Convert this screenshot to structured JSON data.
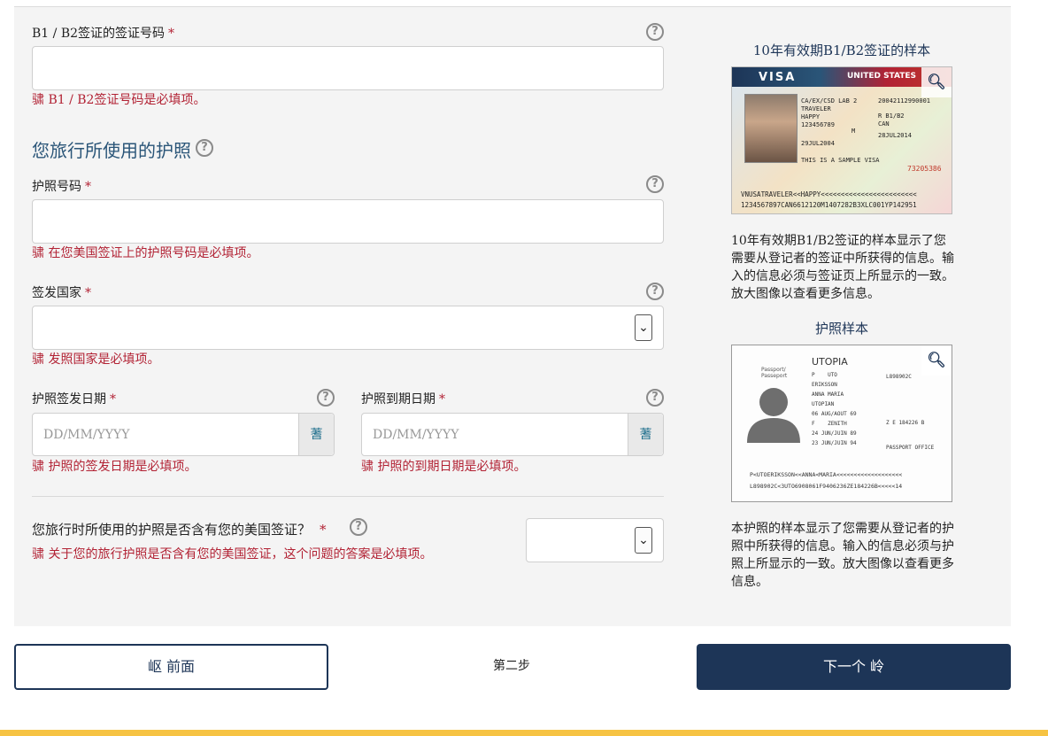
{
  "visa_number": {
    "label": "B1 / B2签证的签证号码",
    "required_mark": "*",
    "value": "",
    "error": "骕 B1 / B2签证号码是必填项。"
  },
  "passport_section": {
    "title": "您旅行所使用的护照"
  },
  "passport_number": {
    "label": "护照号码",
    "required_mark": "*",
    "value": "",
    "error": "骕 在您美国签证上的护照号码是必填项。"
  },
  "issuing_country": {
    "label": "签发国家",
    "required_mark": "*",
    "selected": "",
    "error": "骕 发照国家是必填项。"
  },
  "issue_date": {
    "label": "护照签发日期",
    "required_mark": "*",
    "placeholder": "DD/MM/YYYY",
    "error": "骕 护照的签发日期是必填项。"
  },
  "expiry_date": {
    "label": "护照到期日期",
    "required_mark": "*",
    "placeholder": "DD/MM/YYYY",
    "error": "骕 护照的到期日期是必填项。"
  },
  "calendar_glyph": "蓍",
  "contains_visa": {
    "label": "您旅行时所使用的护照是否含有您的美国签证？",
    "required_mark": "*",
    "selected": "",
    "error": "骕 关于您的旅行护照是否含有您的美国签证，这个问题的答案是必填项。"
  },
  "help_glyph": "?",
  "select_arrow_glyph": "⌄",
  "sidebar": {
    "visa_sample_title": "10年有效期B1/B2签证的样本",
    "visa_sample_desc": "10年有效期B1/B2签证的样本显示了您需要从登记者的签证中所获得的信息。输入的信息必须与签证页上所显示的一致。放大图像以查看更多信息。",
    "passport_sample_title": "护照样本",
    "passport_sample_desc": "本护照的样本显示了您需要从登记者的护照中所获得的信息。输入的信息必须与护照上所显示的一致。放大图像以查看更多信息。",
    "zoom_icon": "magnifier-icon"
  },
  "visa_card": {
    "header": "VISA",
    "country": "UNITED STATES",
    "lines": [
      "CA/EX/CSD LAB 2",
      "TRAVELER",
      "HAPPY",
      "123456789",
      "29JUL2004",
      "THIS IS A SAMPLE VISA"
    ],
    "control": "20042112990001",
    "type": "R    B1/B2",
    "nationality": "CAN",
    "expiry": "28JUL2014",
    "entries": "M",
    "serial": "73205386",
    "mrz1": "VNUSATRAVELER<<HAPPY<<<<<<<<<<<<<<<<<<<<<<<<",
    "mrz2": "1234567897CAN6612120M1407282B3XLC001YP142951"
  },
  "passport_card": {
    "country": "UTOPIA",
    "type_label": "Passport/ Passeport",
    "type": "P",
    "code": "UTO",
    "number": "L898902C",
    "surname": "ERIKSSON",
    "given": "ANNA MARIA",
    "nationality": "UTOPIAN",
    "dob": "06 AUG/AOUT 69",
    "sex": "F",
    "place": "ZENITH",
    "issued": "24 JUN/JUIN 89",
    "expires": "23 JUN/JUIN 94",
    "authority": "PASSPORT OFFICE",
    "personal_no": "Z E 184226 B",
    "mrz1": "P<UTOERIKSSON<<ANNA<MARIA<<<<<<<<<<<<<<<<<<<",
    "mrz2": "L898902C<3UTO6908061F9406236ZE184226B<<<<<14"
  },
  "nav": {
    "prev_label": "岖 前面",
    "step_label": "第二步",
    "next_label": "下一个 岭"
  }
}
